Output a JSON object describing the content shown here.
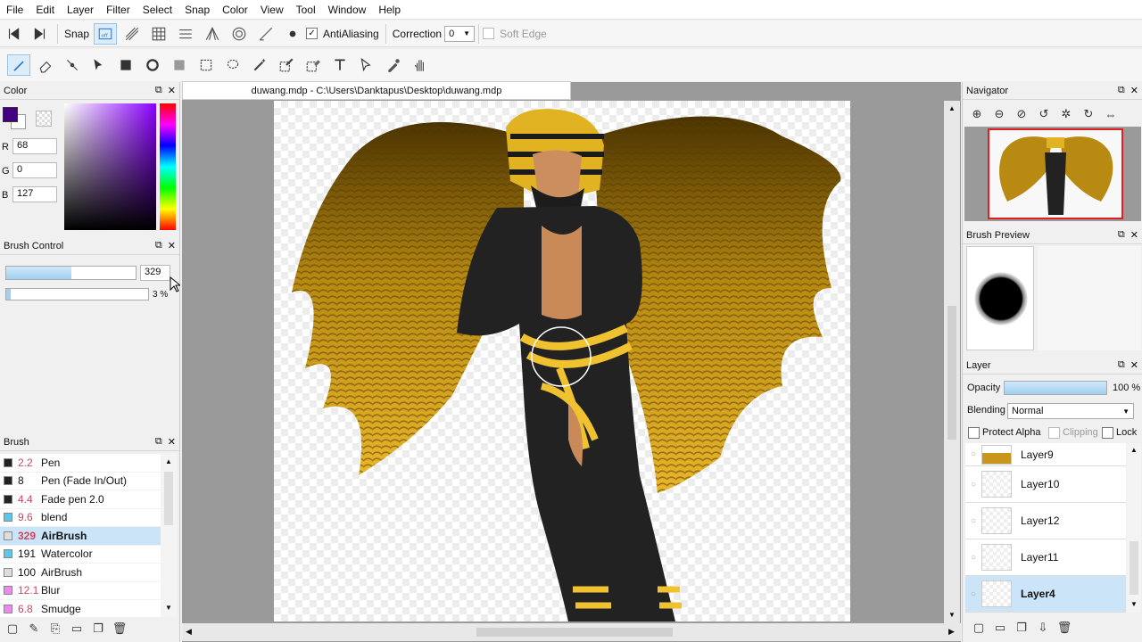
{
  "menu": [
    "File",
    "Edit",
    "Layer",
    "Filter",
    "Select",
    "Snap",
    "Color",
    "View",
    "Tool",
    "Window",
    "Help"
  ],
  "toolbar": {
    "snap_label": "Snap",
    "antialiasing_label": "AntiAliasing",
    "correction_label": "Correction",
    "correction_value": "0",
    "soft_edge_label": "Soft Edge"
  },
  "document": {
    "title": "duwang.mdp - C:\\Users\\Danktapus\\Desktop\\duwang.mdp"
  },
  "color_panel": {
    "title": "Color",
    "r_label": "R",
    "r_value": "68",
    "g_label": "G",
    "g_value": "0",
    "b_label": "B",
    "b_value": "127",
    "foreground": "#44007f"
  },
  "brush_control": {
    "title": "Brush Control",
    "size_value": "329",
    "opacity_value": "3 %",
    "size_fraction": 0.5,
    "opacity_fraction": 0.03
  },
  "brush_panel": {
    "title": "Brush",
    "items": [
      {
        "size": "2.2",
        "name": "Pen",
        "color": "#222222",
        "size_color": "#d0455e"
      },
      {
        "size": "8",
        "name": "Pen (Fade In/Out)",
        "color": "#222222",
        "size_color": "#111111"
      },
      {
        "size": "4.4",
        "name": "Fade pen 2.0",
        "color": "#222222",
        "size_color": "#d0455e"
      },
      {
        "size": "9.6",
        "name": "blend",
        "color": "#5ec6e8",
        "size_color": "#d0455e"
      },
      {
        "size": "329",
        "name": "AirBrush",
        "color": "#dddddd",
        "size_color": "#d0455e"
      },
      {
        "size": "191",
        "name": "Watercolor",
        "color": "#5ec6e8",
        "size_color": "#111111"
      },
      {
        "size": "100",
        "name": "AirBrush",
        "color": "#dddddd",
        "size_color": "#111111"
      },
      {
        "size": "12.1",
        "name": "Blur",
        "color": "#ee88ee",
        "size_color": "#d0455e"
      },
      {
        "size": "6.8",
        "name": "Smudge",
        "color": "#ee88ee",
        "size_color": "#d0455e"
      }
    ]
  },
  "navigator": {
    "title": "Navigator"
  },
  "brush_preview": {
    "title": "Brush Preview"
  },
  "layer_panel": {
    "title": "Layer",
    "opacity_label": "Opacity",
    "opacity_value": "100 %",
    "opacity_fraction": 1.0,
    "blending_label": "Blending",
    "blending_value": "Normal",
    "protect_alpha_label": "Protect Alpha",
    "clipping_label": "Clipping",
    "lock_label": "Lock",
    "layers": [
      "Layer9",
      "Layer10",
      "Layer12",
      "Layer11",
      "Layer4"
    ]
  },
  "colors": {
    "accent": "#cce4f7",
    "slider": "#9fd0f0"
  }
}
